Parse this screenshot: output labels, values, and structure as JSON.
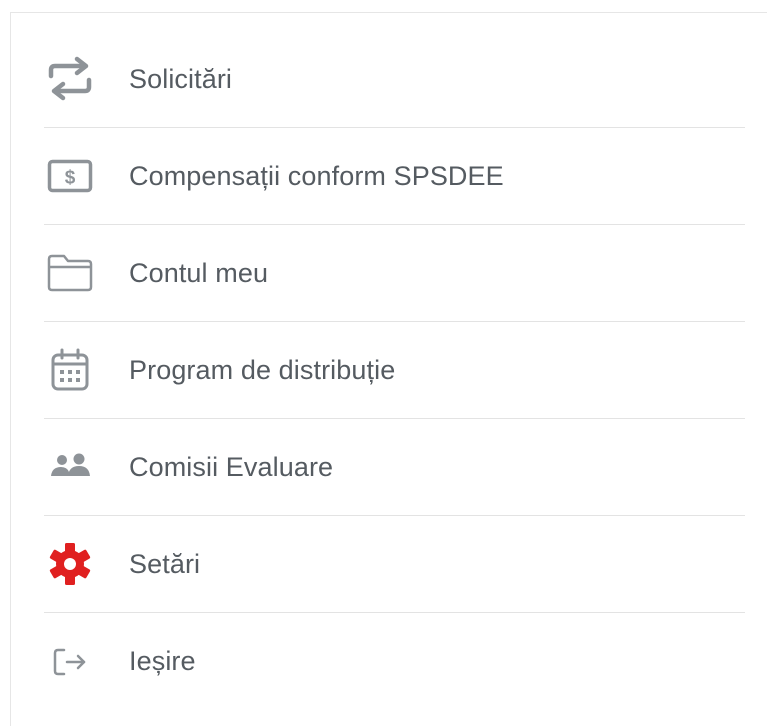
{
  "menu": {
    "items": [
      {
        "label": "Solicitări",
        "icon": "swap-arrows-icon"
      },
      {
        "label": "Compensații conform SPSDEE",
        "icon": "dollar-bill-icon"
      },
      {
        "label": "Contul meu",
        "icon": "folder-icon"
      },
      {
        "label": "Program de distribuție",
        "icon": "calendar-icon"
      },
      {
        "label": "Comisii Evaluare",
        "icon": "users-icon"
      },
      {
        "label": "Setări",
        "icon": "gear-icon"
      },
      {
        "label": "Ieșire",
        "icon": "logout-icon"
      }
    ]
  },
  "colors": {
    "icon_gray": "#8e9398",
    "icon_active": "#e02020",
    "text": "#555b61",
    "divider": "#e3e3e3"
  }
}
